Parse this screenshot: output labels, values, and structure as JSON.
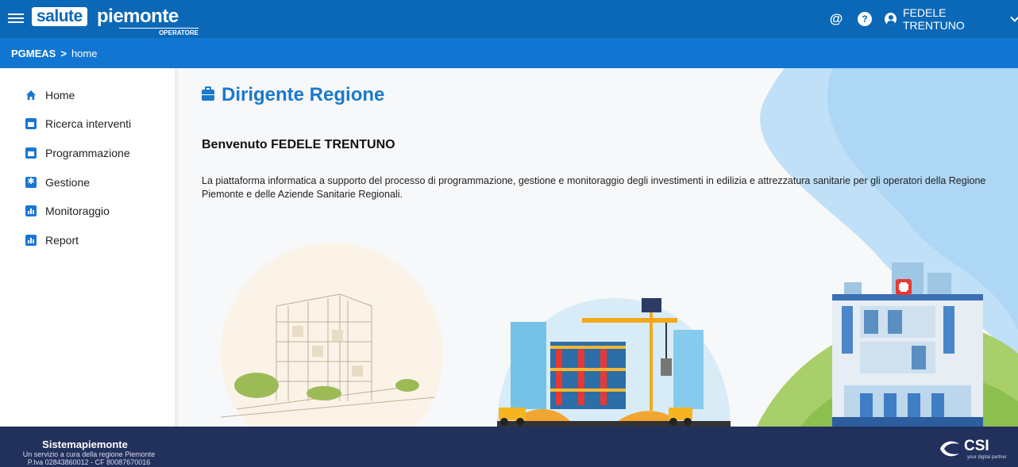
{
  "header": {
    "logo_box": "salute",
    "logo_word": "piemonte",
    "logo_sub": "OPERATORE",
    "at_icon": "at-icon",
    "help_icon": "help-icon",
    "user_name": "FEDELE TRENTUNO"
  },
  "breadcrumb": {
    "root": "PGMEAS",
    "separator": ">",
    "current": "home"
  },
  "sidebar": {
    "items": [
      {
        "label": "Home",
        "icon": "home-icon"
      },
      {
        "label": "Ricerca interventi",
        "icon": "calendar-icon"
      },
      {
        "label": "Programmazione",
        "icon": "calendar-icon"
      },
      {
        "label": "Gestione",
        "icon": "settings-icon"
      },
      {
        "label": "Monitoraggio",
        "icon": "chart-icon"
      },
      {
        "label": "Report",
        "icon": "chart-icon"
      }
    ]
  },
  "main": {
    "title": "Dirigente Regione",
    "welcome": "Benvenuto FEDELE TRENTUNO",
    "description": "La piattaforma informatica a supporto del processo di programmazione, gestione e monitoraggio degli investimenti in edilizia e attrezzatura sanitarie per gli operatori della Regione Piemonte e delle Aziende Sanitarie Regionali."
  },
  "footer": {
    "title": "Sistemapiemonte",
    "line1": "Un servizio a cura della regione Piemonte",
    "line2": "P.Iva 02843860012 - CF 80087670016",
    "brand": "CSI",
    "brand_sub": "your digital partner"
  },
  "colors": {
    "header_blue": "#0b68b7",
    "breadcrumb_blue": "#1176d1",
    "accent": "#1b79cc",
    "footer_navy": "#22305c"
  }
}
